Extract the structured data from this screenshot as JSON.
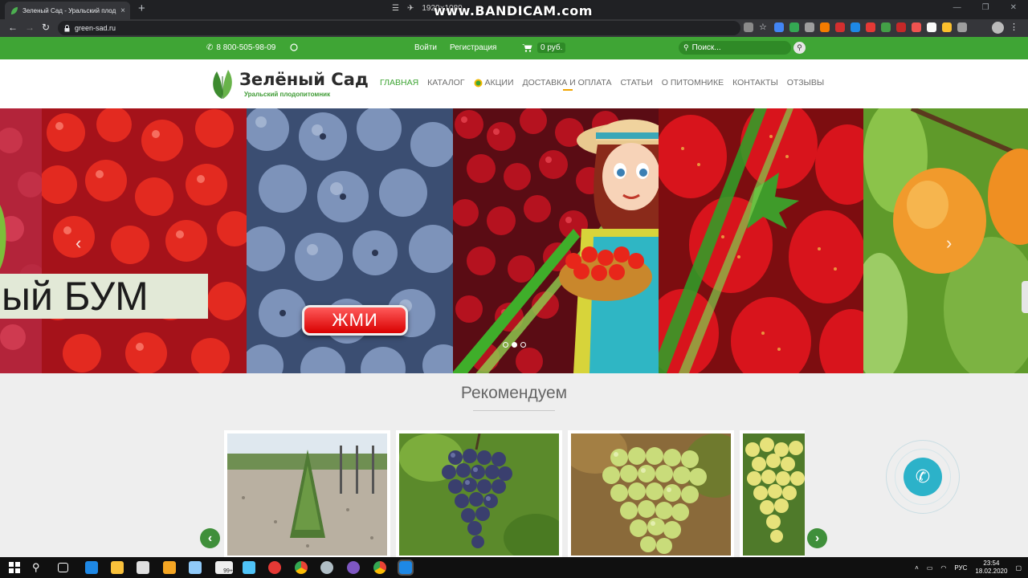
{
  "browser": {
    "tab_title": "Зеленый Сад - Уральский плод",
    "tab_close": "×",
    "new_tab": "+",
    "watermark": "www.BANDICAM.com",
    "recording_resolution": "1920×1080",
    "url": "green-sad.ru",
    "win_controls": [
      "—",
      "❐",
      "✕"
    ]
  },
  "topbar": {
    "phone": "8 800-505-98-09",
    "login": "Войти",
    "register": "Регистрация",
    "cart_sum": "0 руб.",
    "search_placeholder": "Поиск..."
  },
  "logo": {
    "name": "Зелёный Сад",
    "subtitle": "Уральский плодопитомник"
  },
  "menu": [
    {
      "label": "ГЛАВНАЯ"
    },
    {
      "label": "КАТАЛОГ"
    },
    {
      "label": "АКЦИИ"
    },
    {
      "label": "ДОСТАВКА И ОПЛАТА"
    },
    {
      "label": "СТАТЬИ"
    },
    {
      "label": "О ПИТОМНИКЕ"
    },
    {
      "label": "КОНТАКТЫ"
    },
    {
      "label": "ОТЗЫВЫ"
    }
  ],
  "slider": {
    "banner_text": "ый БУМ",
    "button_label": "ЖМИ",
    "dots_count": 3,
    "active_dot": 1
  },
  "recommend": {
    "title": "Рекомендуем"
  },
  "taskbar": {
    "language": "РУС",
    "time": "23:54",
    "date": "18.02.2020",
    "badge": "99+"
  },
  "colors": {
    "brand_green": "#3fa535",
    "accent_orange": "#f0a400",
    "call_button": "#2cb2c9"
  }
}
